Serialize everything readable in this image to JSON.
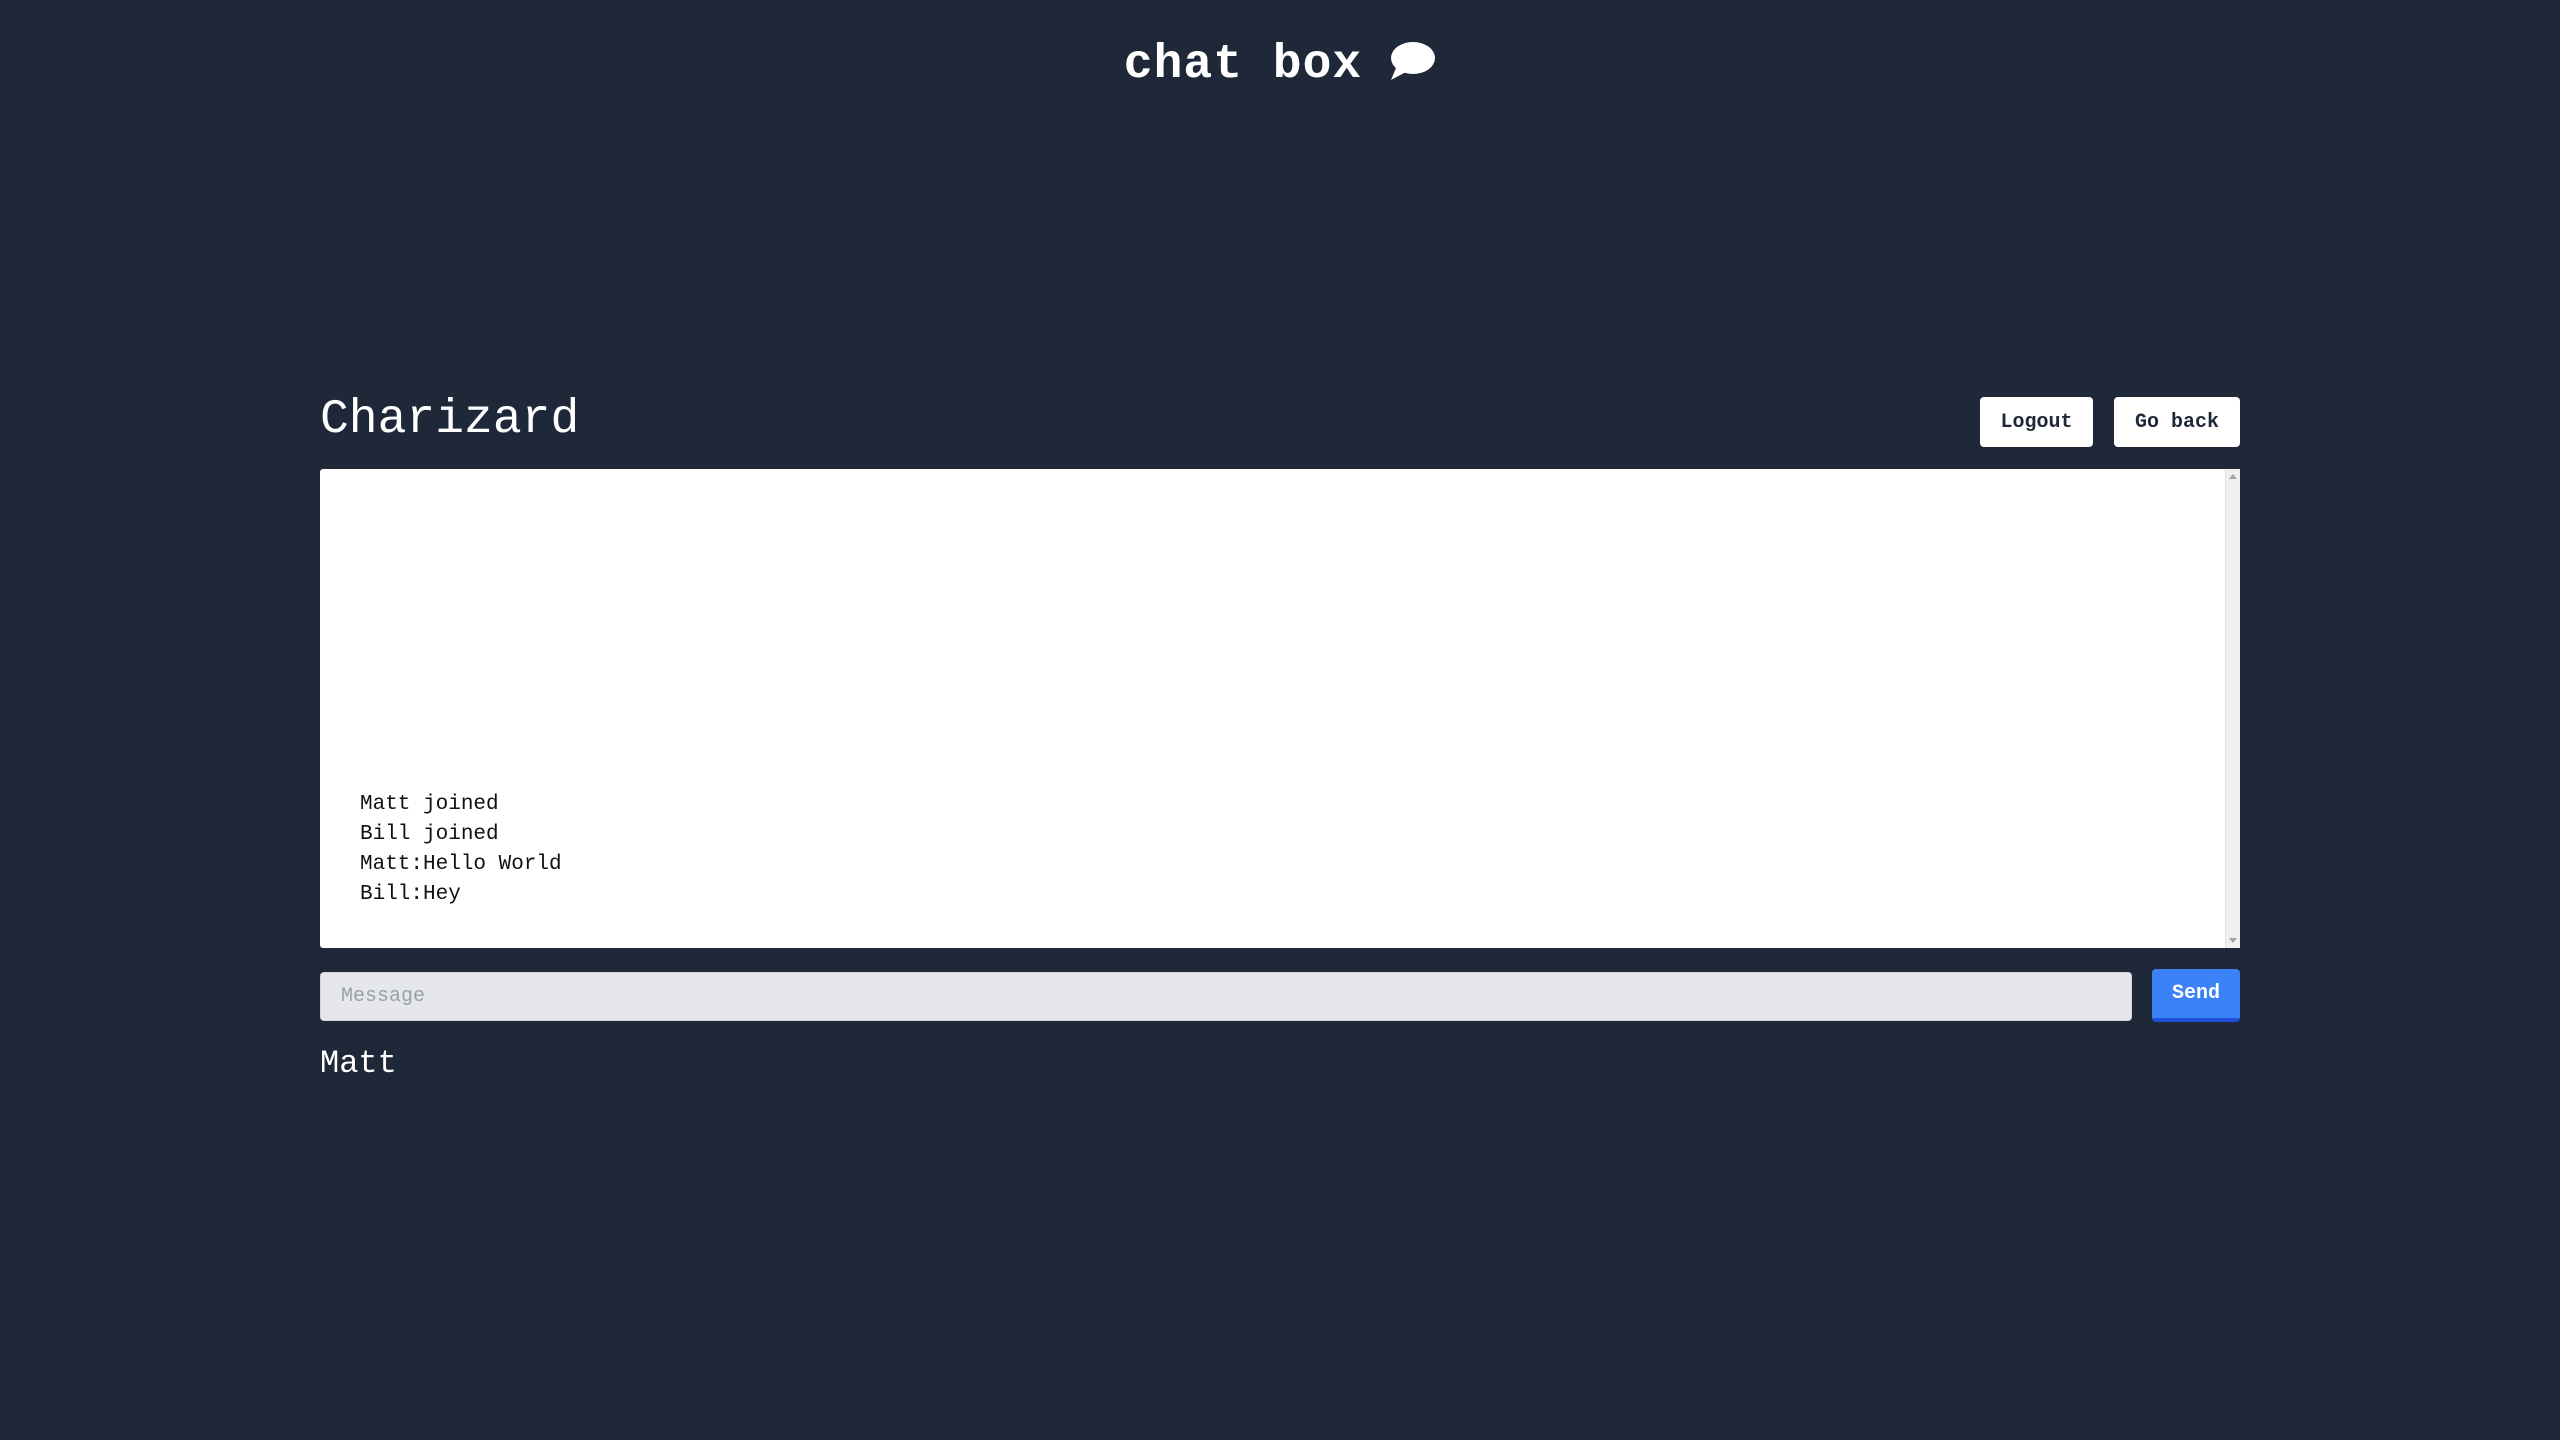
{
  "app": {
    "title": "chat box",
    "title_icon": "chat-bubble-icon"
  },
  "room": {
    "name": "Charizard"
  },
  "toolbar": {
    "logout_label": "Logout",
    "go_back_label": "Go back"
  },
  "messages": [
    "Matt joined",
    "Bill joined",
    "Matt:Hello World",
    "Bill:Hey"
  ],
  "composer": {
    "placeholder": "Message",
    "value": "",
    "send_label": "Send"
  },
  "user": {
    "name": "Matt"
  },
  "colors": {
    "background": "#1f2839",
    "accent": "#3b82f6",
    "panel": "#ffffff",
    "input": "#e5e7eb"
  }
}
